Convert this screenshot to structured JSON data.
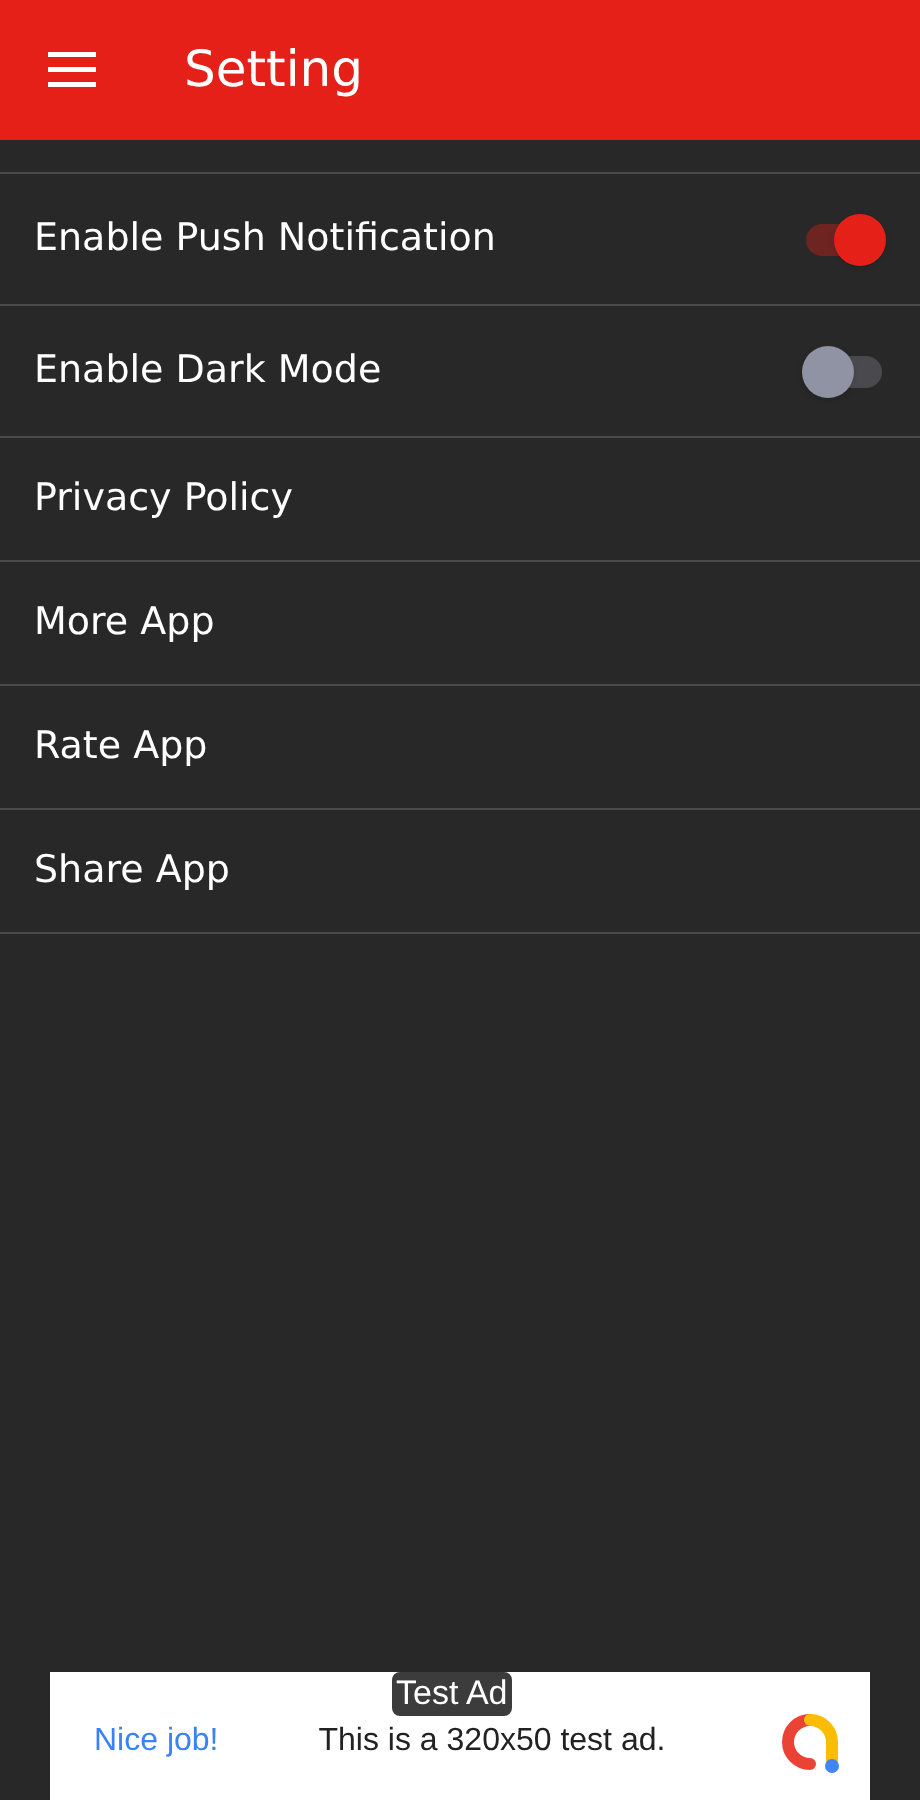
{
  "app_bar": {
    "title": "Setting"
  },
  "items": [
    {
      "kind": "toggle",
      "label": "Enable Push Notification",
      "on": true
    },
    {
      "kind": "toggle",
      "label": "Enable Dark Mode",
      "on": false
    },
    {
      "kind": "link",
      "label": "Privacy Policy"
    },
    {
      "kind": "link",
      "label": "More App"
    },
    {
      "kind": "link",
      "label": "Rate App"
    },
    {
      "kind": "link",
      "label": "Share App"
    }
  ],
  "ad": {
    "badge": "Test Ad",
    "headline": "Nice job!",
    "body": "This is a 320x50 test ad."
  }
}
